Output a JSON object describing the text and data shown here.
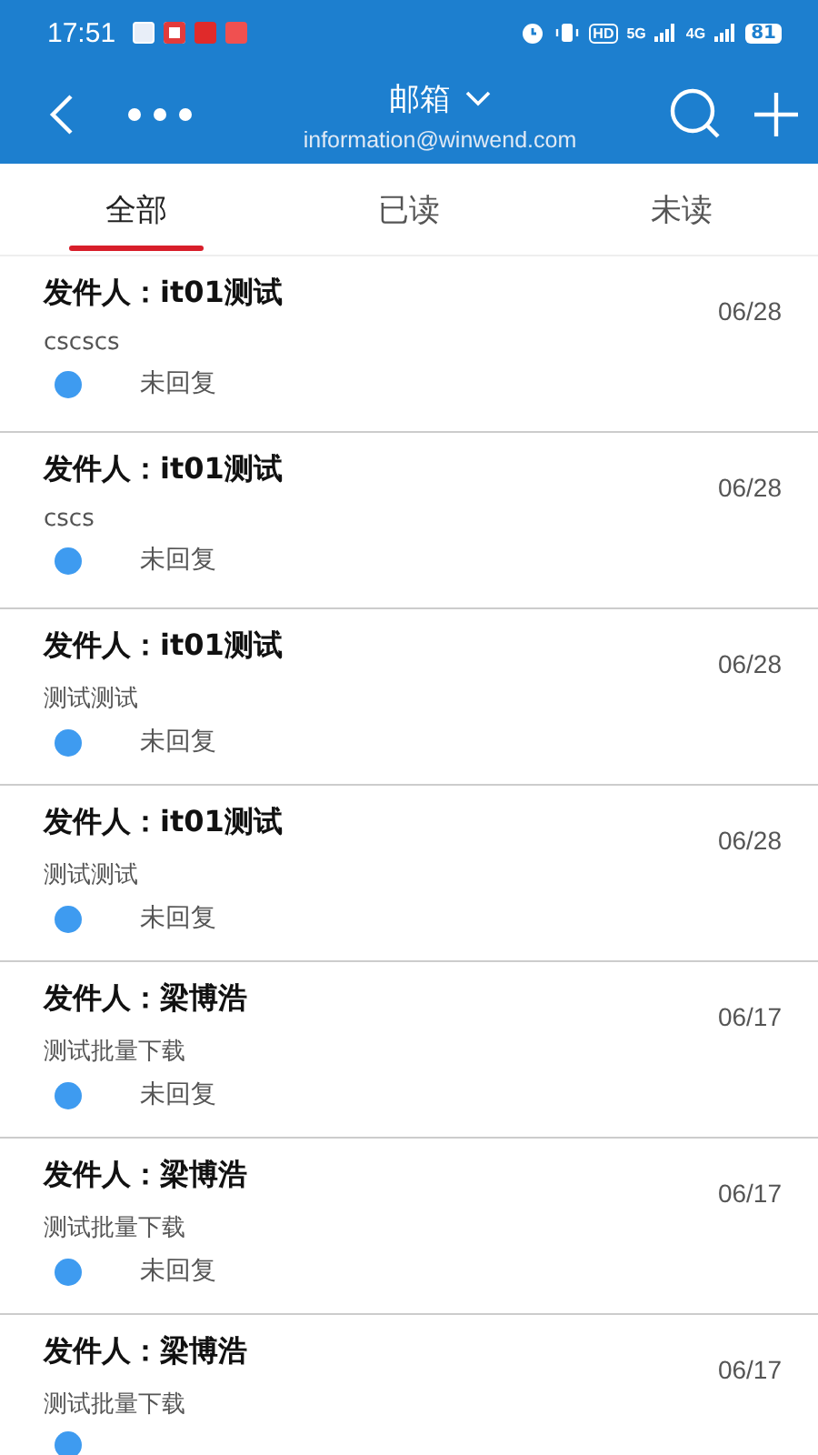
{
  "status_bar": {
    "time": "17:51",
    "network_hd": "HD",
    "network_5g": "5G",
    "network_4g": "4G",
    "battery": "81"
  },
  "header": {
    "title": "邮箱",
    "subtitle": "information@winwend.com"
  },
  "tabs": [
    {
      "label": "全部",
      "selected": true
    },
    {
      "label": "已读",
      "selected": false
    },
    {
      "label": "未读",
      "selected": false
    }
  ],
  "messages": [
    {
      "sender": "发件人：it01测试",
      "date": "06/28",
      "preview": "cscscs",
      "status": "未回复"
    },
    {
      "sender": "发件人：it01测试",
      "date": "06/28",
      "preview": "cscs",
      "status": "未回复"
    },
    {
      "sender": "发件人：it01测试",
      "date": "06/28",
      "preview": "测试测试",
      "status": "未回复"
    },
    {
      "sender": "发件人：it01测试",
      "date": "06/28",
      "preview": "测试测试",
      "status": "未回复"
    },
    {
      "sender": "发件人：梁博浩",
      "date": "06/17",
      "preview": "测试批量下载",
      "status": "未回复"
    },
    {
      "sender": "发件人：梁博浩",
      "date": "06/17",
      "preview": "测试批量下载",
      "status": "未回复"
    },
    {
      "sender": "发件人：梁博浩",
      "date": "06/17",
      "preview": "测试批量下载"
    }
  ]
}
